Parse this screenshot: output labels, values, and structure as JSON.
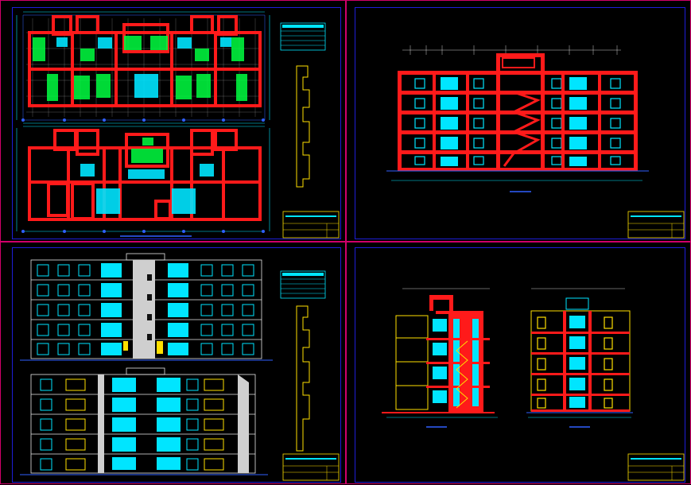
{
  "sheets": [
    {
      "id": "plans",
      "view": "floor-plans"
    },
    {
      "id": "section-long",
      "view": "longitudinal-section"
    },
    {
      "id": "facades",
      "view": "elevations"
    },
    {
      "id": "sections-cross",
      "view": "cross-sections"
    }
  ],
  "title_blocks": {
    "rows": [
      "",
      "",
      "",
      ""
    ]
  },
  "colors": {
    "sheet_border": "#d0006a",
    "frame": "#1e1ed8",
    "wall": "#ff1a1a",
    "cyan": "#00e5ff",
    "yellow": "#ffe000",
    "green": "#00ff40",
    "white": "#e8e8e8",
    "grey": "#cfcfcf",
    "blue_line": "#3060ff"
  }
}
